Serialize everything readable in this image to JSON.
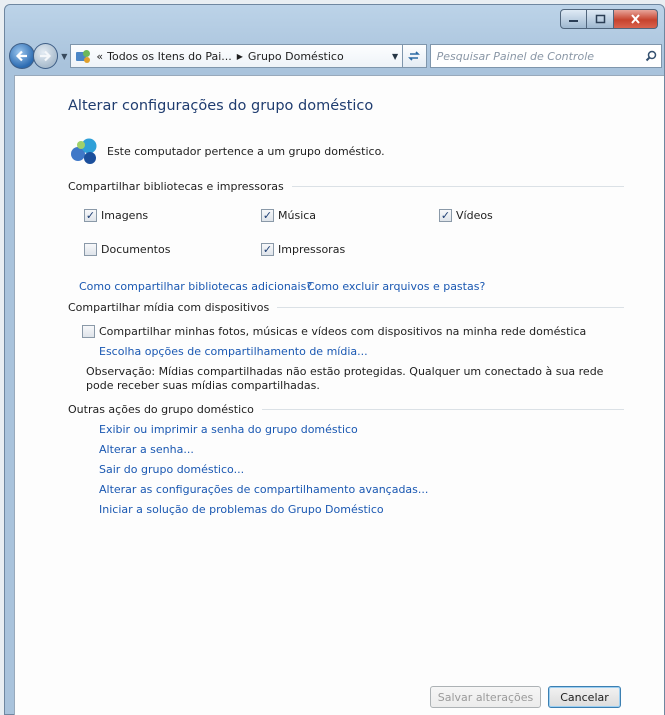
{
  "window": {
    "caption_buttons": {
      "minimize_icon": "minimize-icon",
      "maximize_icon": "maximize-icon",
      "close_icon": "close-icon"
    }
  },
  "navigation": {
    "back_icon": "back-arrow-icon",
    "forward_icon": "forward-arrow-icon",
    "address": {
      "chevron": "«",
      "breadcrumbs": [
        "Todos os Itens do Pai...",
        "Grupo Doméstico"
      ]
    },
    "search": {
      "placeholder": "Pesquisar Painel de Controle"
    }
  },
  "page": {
    "title": "Alterar configurações do grupo doméstico",
    "membership_text": "Este computador pertence a um grupo doméstico.",
    "sections": {
      "libraries": {
        "label": "Compartilhar bibliotecas e impressoras",
        "items": [
          {
            "label": "Imagens",
            "checked": true
          },
          {
            "label": "Música",
            "checked": true
          },
          {
            "label": "Vídeos",
            "checked": true
          },
          {
            "label": "Documentos",
            "checked": false
          },
          {
            "label": "Impressoras",
            "checked": true
          }
        ],
        "links": [
          "Como compartilhar bibliotecas adicionais?",
          "Como excluir arquivos e pastas?"
        ]
      },
      "media": {
        "label": "Compartilhar mídia com dispositivos",
        "checkbox_label": "Compartilhar minhas fotos, músicas e vídeos com dispositivos na minha rede doméstica",
        "checked": false,
        "link": "Escolha opções de compartilhamento de mídia...",
        "note": "Observação: Mídias compartilhadas não estão protegidas. Qualquer um conectado à sua rede pode receber suas mídias compartilhadas."
      },
      "other": {
        "label": "Outras ações do grupo doméstico",
        "links": [
          "Exibir ou imprimir a senha do grupo doméstico",
          "Alterar a senha...",
          "Sair do grupo doméstico...",
          "Alterar as configurações de compartilhamento avançadas...",
          "Iniciar a solução de problemas do Grupo Doméstico"
        ]
      }
    },
    "buttons": {
      "save": "Salvar alterações",
      "cancel": "Cancelar"
    }
  },
  "colors": {
    "link": "#1a58b2",
    "title": "#1f3c6f",
    "accent": "#2c6bb1"
  }
}
